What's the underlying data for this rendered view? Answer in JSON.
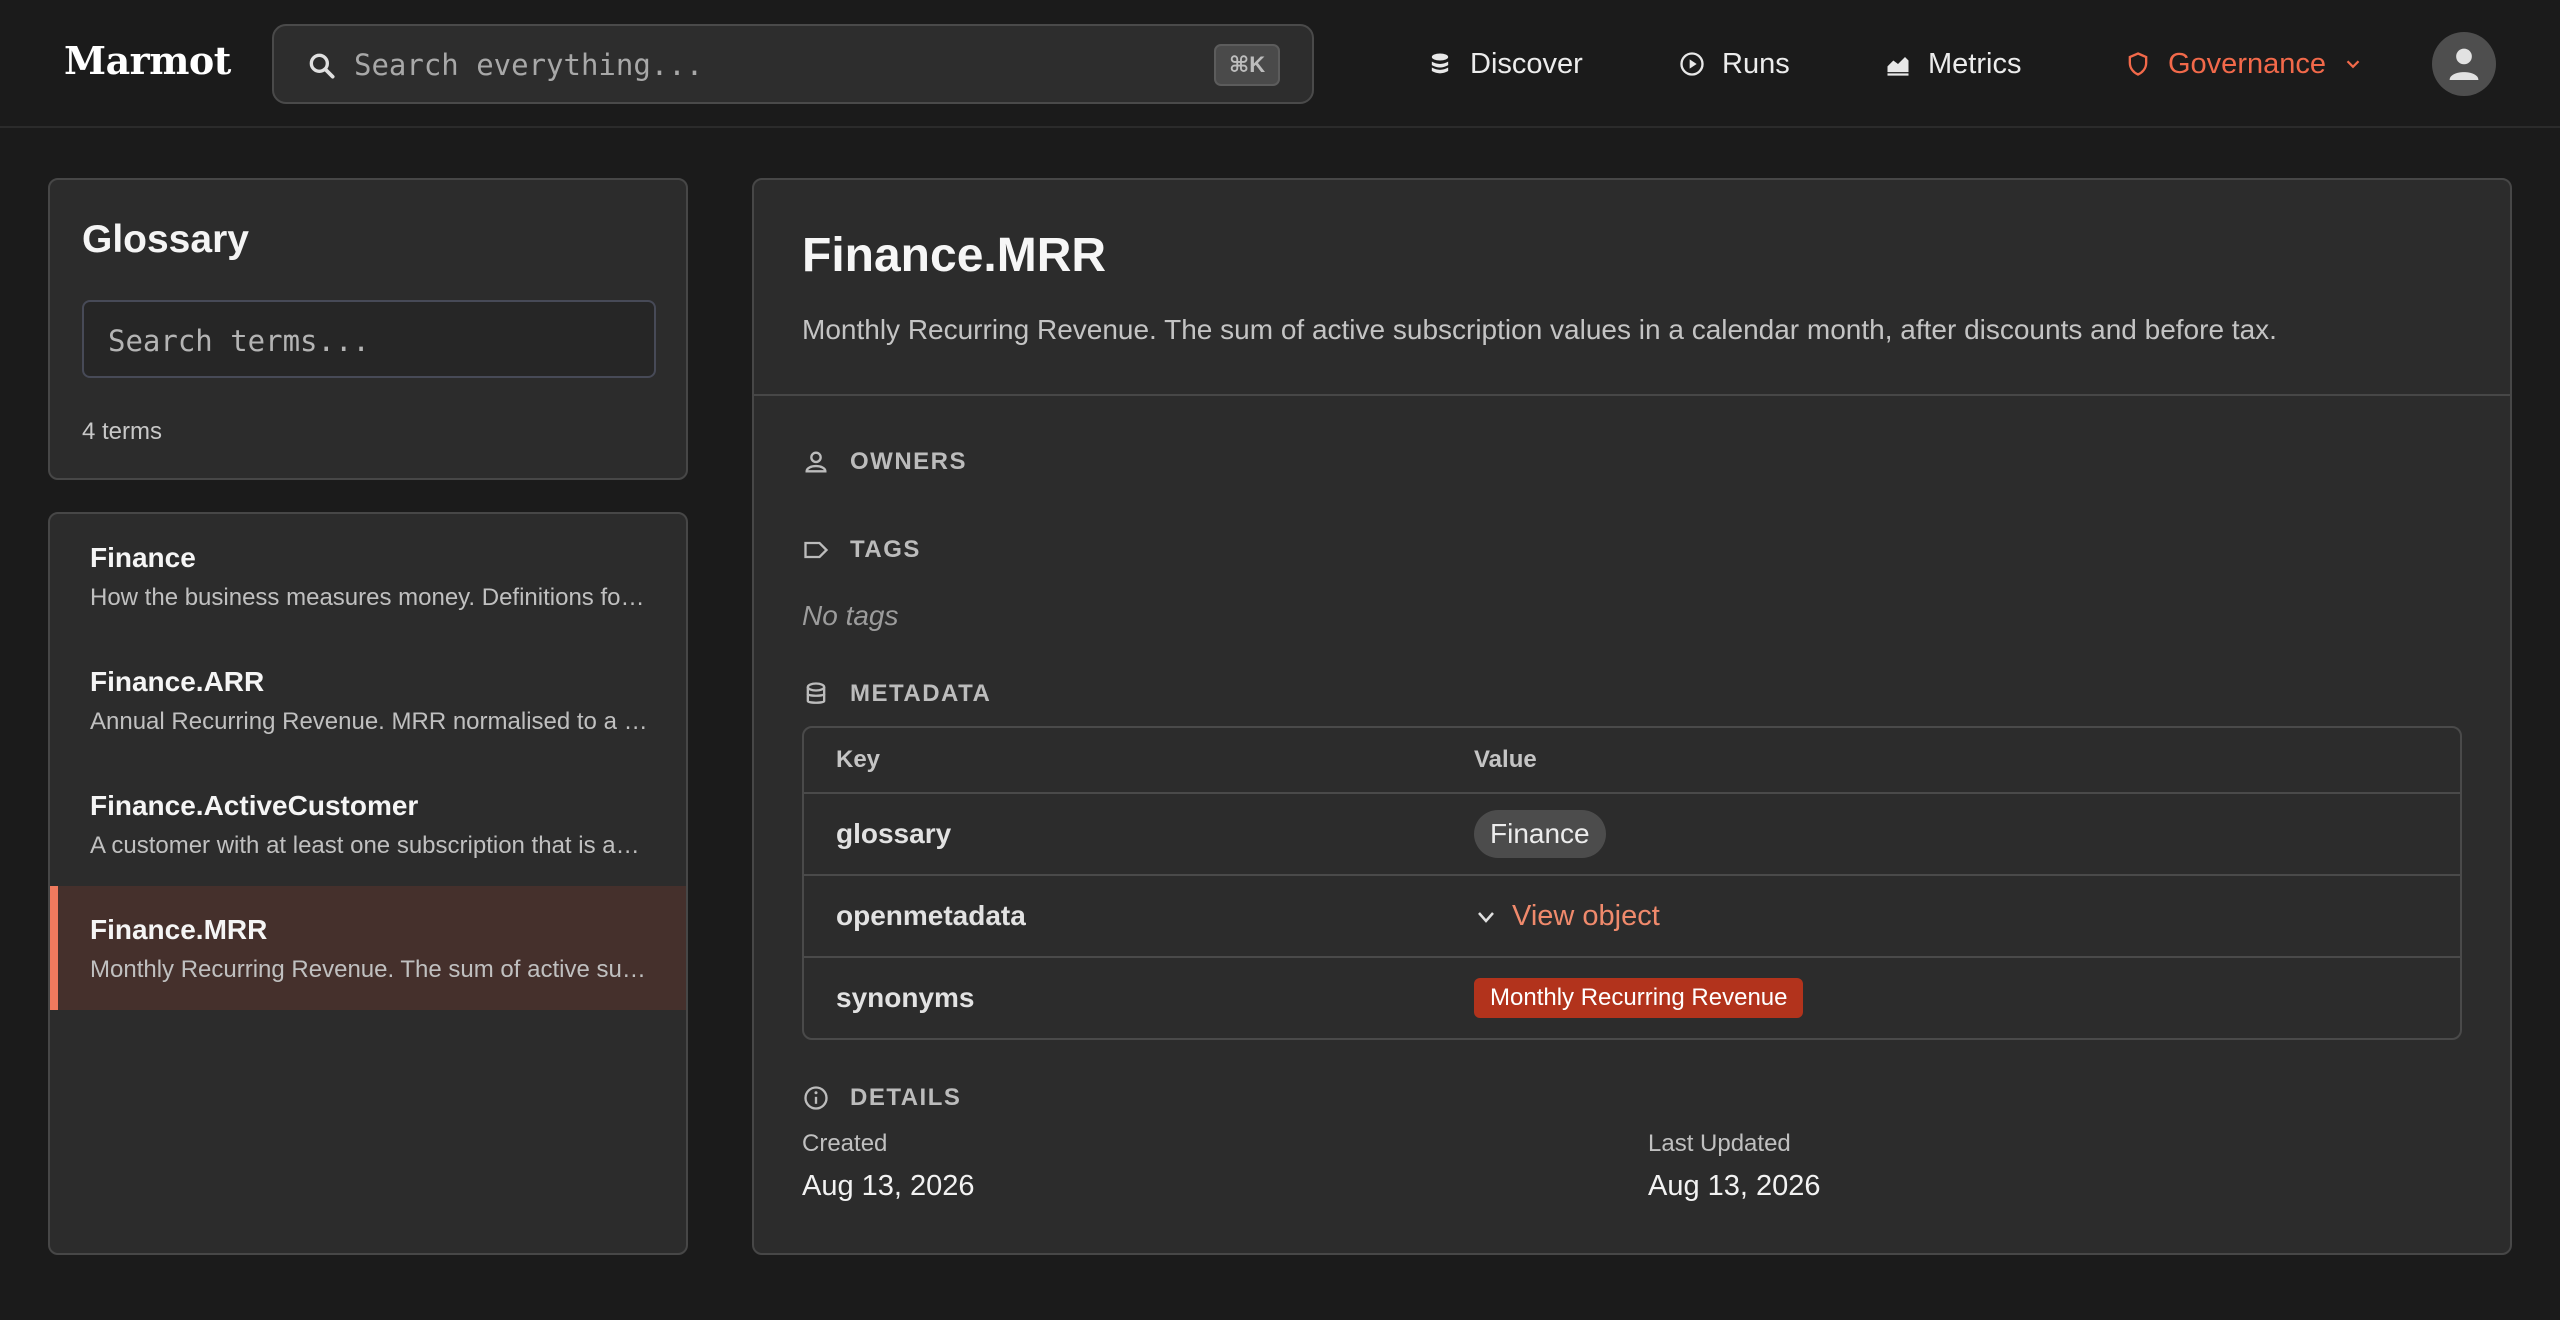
{
  "app": {
    "logo": "Marmot",
    "search_placeholder": "Search everything...",
    "search_shortcut": "⌘K"
  },
  "nav": {
    "discover": "Discover",
    "runs": "Runs",
    "metrics": "Metrics",
    "governance": "Governance",
    "accent_color": "#f2694a"
  },
  "sidebar": {
    "title": "Glossary",
    "search_placeholder": "Search terms...",
    "count": "4 terms",
    "terms": [
      {
        "title": "Finance",
        "desc": "How the business measures money. Definitions for revenue, customers and related metrics."
      },
      {
        "title": "Finance.ARR",
        "desc": "Annual Recurring Revenue. MRR normalised to a yearly figure."
      },
      {
        "title": "Finance.ActiveCustomer",
        "desc": "A customer with at least one subscription that is active."
      },
      {
        "title": "Finance.MRR",
        "desc": "Monthly Recurring Revenue. The sum of active subscription values in a calendar month."
      }
    ],
    "active_index": 3
  },
  "detail": {
    "title": "Finance.MRR",
    "description": "Monthly Recurring Revenue. The sum of active subscription values in a calendar month, after discounts and before tax.",
    "owners_label": "OWNERS",
    "tags_label": "TAGS",
    "no_tags": "No tags",
    "metadata_label": "METADATA",
    "metadata": {
      "col_key": "Key",
      "col_value": "Value",
      "rows": [
        {
          "key": "glossary",
          "value": "Finance"
        },
        {
          "key": "openmetadata",
          "value": "View object"
        },
        {
          "key": "synonyms",
          "value": "Monthly Recurring Revenue"
        }
      ]
    },
    "details_label": "DETAILS",
    "created_label": "Created",
    "created_value": "Aug 13, 2026",
    "updated_label": "Last Updated",
    "updated_value": "Aug 13, 2026"
  }
}
